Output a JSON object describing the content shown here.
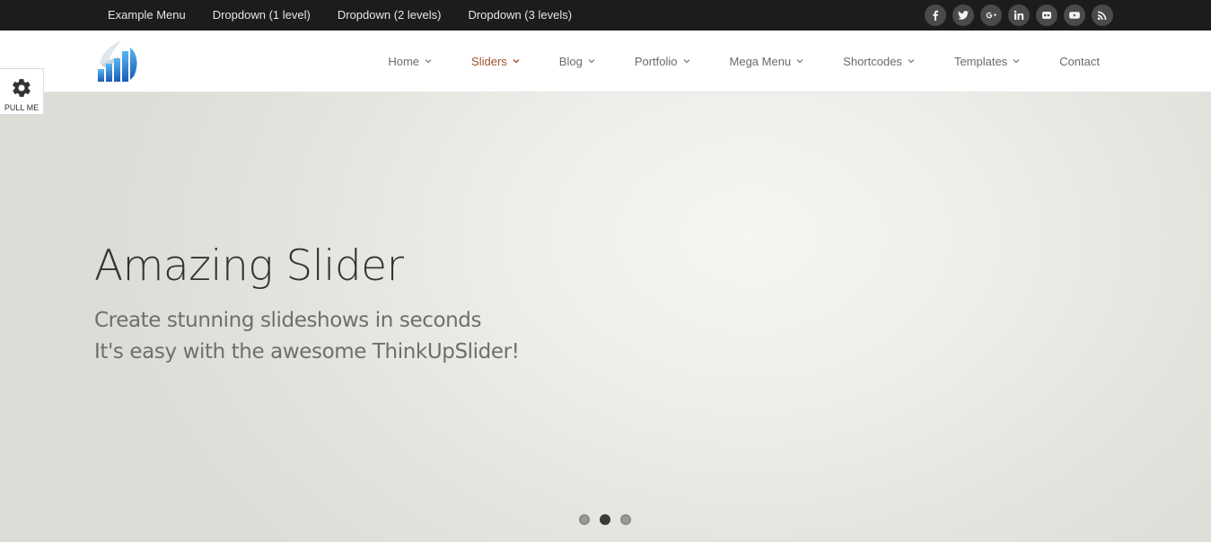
{
  "topbar": {
    "menu": [
      {
        "label": "Example Menu"
      },
      {
        "label": "Dropdown (1 level)"
      },
      {
        "label": "Dropdown (2 levels)"
      },
      {
        "label": "Dropdown (3 levels)"
      }
    ],
    "social": [
      "facebook-icon",
      "twitter-icon",
      "google-plus-icon",
      "linkedin-icon",
      "flickr-icon",
      "youtube-icon",
      "rss-icon"
    ]
  },
  "header": {
    "nav": [
      {
        "label": "Home",
        "has_dropdown": true
      },
      {
        "label": "Sliders",
        "has_dropdown": true,
        "active": true
      },
      {
        "label": "Blog",
        "has_dropdown": true
      },
      {
        "label": "Portfolio",
        "has_dropdown": true
      },
      {
        "label": "Mega Menu",
        "has_dropdown": true
      },
      {
        "label": "Shortcodes",
        "has_dropdown": true
      },
      {
        "label": "Templates",
        "has_dropdown": true
      },
      {
        "label": "Contact",
        "has_dropdown": false
      }
    ],
    "active_color": "#a0522d"
  },
  "pullme": {
    "label": "PULL ME",
    "icon": "gear-icon"
  },
  "slider": {
    "title": "Amazing Slider",
    "line1": "Create stunning slideshows in seconds",
    "line2": "It's easy with the awesome ThinkUpSlider!",
    "slide_count": 3,
    "active_slide": 2
  }
}
